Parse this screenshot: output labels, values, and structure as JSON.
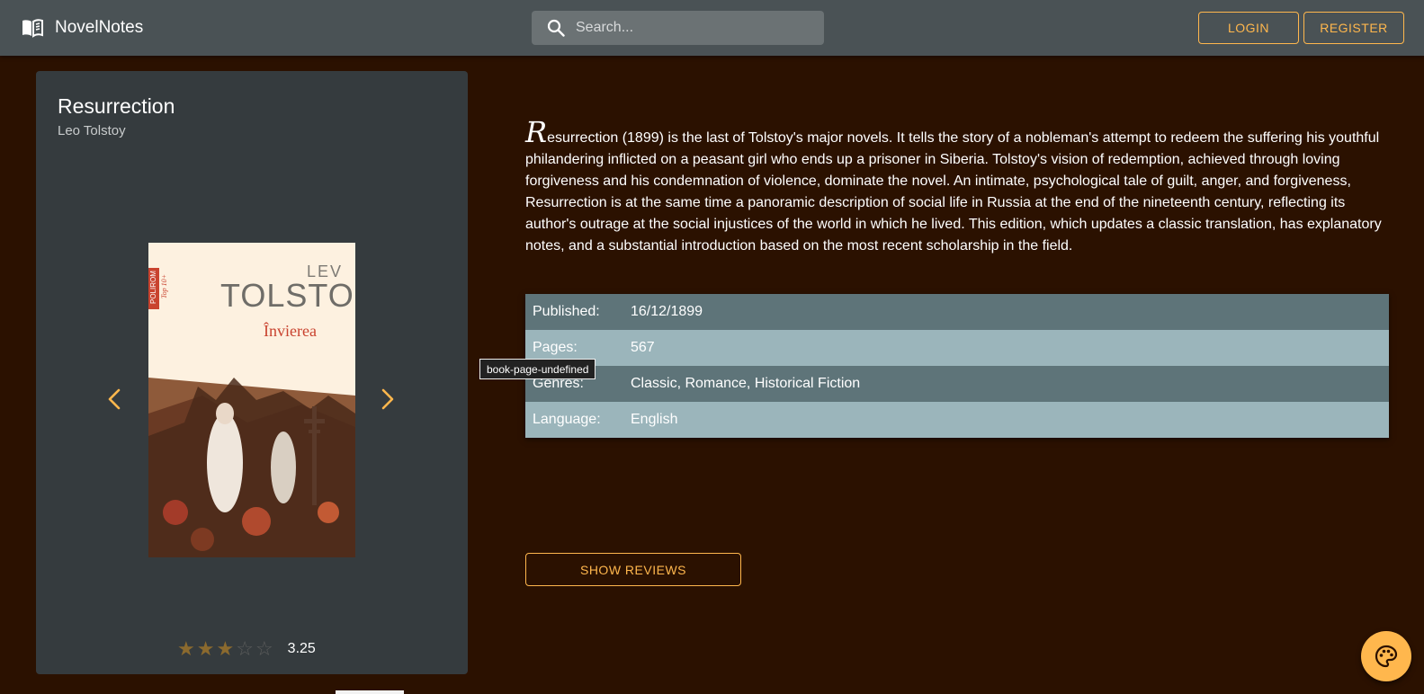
{
  "header": {
    "app_name": "NovelNotes",
    "search_placeholder": "Search...",
    "login_label": "LOGIN",
    "register_label": "REGISTER"
  },
  "book": {
    "title": "Resurrection",
    "author": "Leo Tolstoy",
    "cover_author_first": "LEV",
    "cover_author_last": "TOLSTOI",
    "cover_title": "Învierea",
    "cover_series": "POLIROM",
    "cover_badge": "Top 10+",
    "rating_value": "3.25",
    "rating_stars": 3,
    "rating_max": 5,
    "description_initial": "R",
    "description_rest": "esurrection (1899) is the last of Tolstoy's major novels. It tells the story of a nobleman's attempt to redeem the suffering his youthful philandering inflicted on a peasant girl who ends up a prisoner in Siberia. Tolstoy's vision of redemption, achieved through loving forgiveness and his condemnation of violence, dominate the novel. An intimate, psychological tale of guilt, anger, and forgiveness, Resurrection is at the same time a panoramic description of social life in Russia at the end of the nineteenth century, reflecting its author's outrage at the social injustices of the world in which he lived. This edition, which updates a classic translation, has explanatory notes, and a substantial introduction based on the most recent scholarship in the field.",
    "details": [
      {
        "label": "Published:",
        "value": "16/12/1899"
      },
      {
        "label": "Pages:",
        "value": "567"
      },
      {
        "label": "Genres:",
        "value": "Classic, Romance, Historical Fiction"
      },
      {
        "label": "Language:",
        "value": "English"
      }
    ]
  },
  "tooltip_text": "book-page-undefined",
  "show_reviews_label": "SHOW REVIEWS",
  "icons": {
    "brand": "book-open-icon",
    "search": "search-icon",
    "prev": "chevron-left-icon",
    "next": "chevron-right-icon",
    "theme": "palette-icon"
  },
  "colors": {
    "accent": "#ffb74d",
    "background": "#2b1100",
    "appbar": "#4a5255",
    "card": "#353b3e",
    "row_dark": "#5e7479",
    "row_light": "#9bb5bb"
  }
}
